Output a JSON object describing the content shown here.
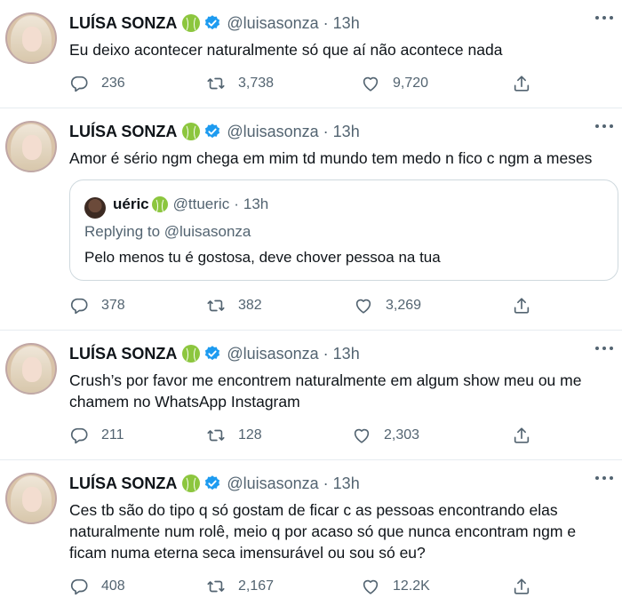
{
  "colors": {
    "verified": "#1d9bf0",
    "secondary_text": "#536471",
    "ball": "#8cc63e"
  },
  "tweets": [
    {
      "name": "LUÍSA SONZA",
      "handle": "@luisasonza",
      "separator": "·",
      "time": "13h",
      "text": "Eu deixo acontecer naturalmente só que aí não acontece nada",
      "replies": "236",
      "retweets": "3,738",
      "likes": "9,720"
    },
    {
      "name": "LUÍSA SONZA",
      "handle": "@luisasonza",
      "separator": "·",
      "time": "13h",
      "text": "Amor é sério ngm chega em mim td mundo tem medo n fico c ngm a meses",
      "quote": {
        "name": "uéric",
        "handle": "@ttueric",
        "separator": "·",
        "time": "13h",
        "replying": "Replying to @luisasonza",
        "text": "Pelo menos tu é gostosa, deve chover pessoa na tua"
      },
      "replies": "378",
      "retweets": "382",
      "likes": "3,269"
    },
    {
      "name": "LUÍSA SONZA",
      "handle": "@luisasonza",
      "separator": "·",
      "time": "13h",
      "text": "Crush’s por favor me encontrem naturalmente em algum show meu ou me chamem no WhatsApp Instagram",
      "replies": "211",
      "retweets": "128",
      "likes": "2,303"
    },
    {
      "name": "LUÍSA SONZA",
      "handle": "@luisasonza",
      "separator": "·",
      "time": "13h",
      "text": "Ces tb são do tipo q só gostam de ficar c as pessoas encontrando elas naturalmente num rolê, meio q por acaso só que nunca encontram ngm e ficam numa eterna seca imensurável ou sou só eu?",
      "replies": "408",
      "retweets": "2,167",
      "likes": "12.2K"
    }
  ]
}
